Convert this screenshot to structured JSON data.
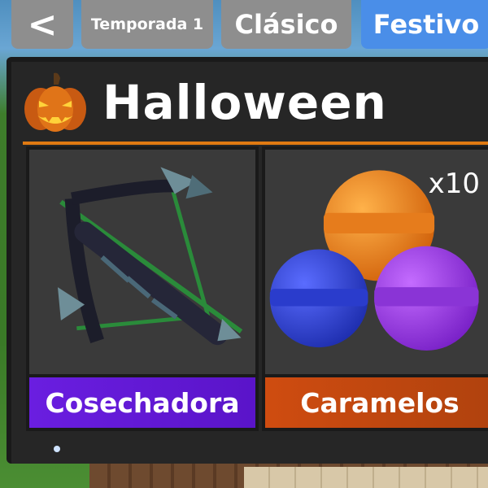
{
  "tabs": {
    "back_label": "<",
    "season_label": "Temporada 1",
    "classic_label": "Clásico",
    "festive_label": "Festivo"
  },
  "header": {
    "title": "Halloween",
    "icon": "pumpkin-icon"
  },
  "items": [
    {
      "name": "Cosechadora",
      "icon": "crossbow-icon",
      "color": "#6a1ee0"
    },
    {
      "name": "Caramelos",
      "icon": "candy-icon",
      "quantity": "x10",
      "color": "#cf4c10"
    }
  ],
  "colors": {
    "accent": "#e07a12",
    "active_tab": "#4a8ee8",
    "inactive_tab": "#8e8e8e"
  }
}
